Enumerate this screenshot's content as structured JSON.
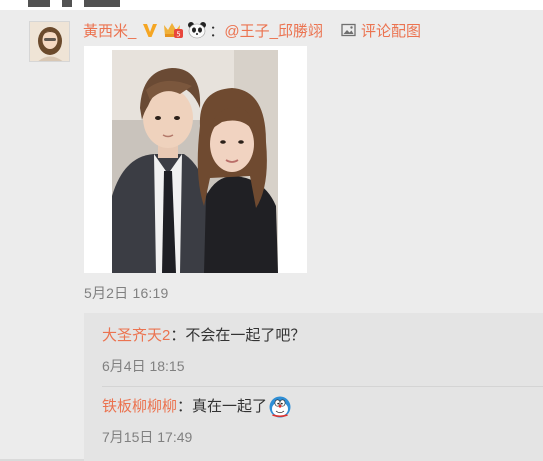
{
  "comment": {
    "username": "黃西米_",
    "verified_icon": "verified-v-icon",
    "level_badge_icon": "member-level-badge-icon",
    "panda_icon": "panda-emoji-icon",
    "colon": "：",
    "mention": "@王子_邱勝翊",
    "pic_link_icon": "image-icon",
    "pic_link_label": "评论配图",
    "time": "5月2日 16:19"
  },
  "replies": [
    {
      "username": "大圣齐天2",
      "colon": "：",
      "text": "不会在一起了吧？",
      "time": "6月4日 18:15"
    },
    {
      "username": "铁板柳柳柳",
      "colon": "：",
      "text": "真在一起了",
      "emoji_icon": "doraemon-emoji-icon",
      "time": "7月15日 17:49"
    }
  ],
  "colors": {
    "link": "#eb7350",
    "text": "#333333",
    "time": "#808080",
    "background": "#ececec",
    "reply_background": "#e4e4e4"
  }
}
